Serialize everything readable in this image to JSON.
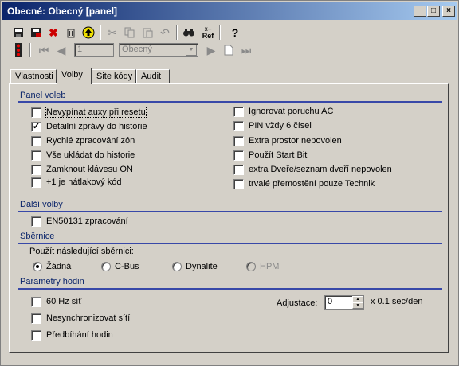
{
  "window": {
    "title": "Obecné: Obecný [panel]",
    "controls": {
      "minimize": "_",
      "maximize": "□",
      "close": "×"
    }
  },
  "toolbar": {
    "icons": [
      "save-icon",
      "save-all-icon",
      "delete-icon",
      "trash-icon",
      "up-icon",
      "cut-icon",
      "copy-icon",
      "paste-icon",
      "undo-icon",
      "find-icon",
      "cross-ref-icon",
      "help-icon"
    ],
    "xref_label": "Ref",
    "help_label": "?"
  },
  "navbar": {
    "record_number": "1",
    "record_name": "Obecný"
  },
  "tabs": [
    {
      "label": "Vlastnosti",
      "active": false
    },
    {
      "label": "Volby",
      "active": true
    },
    {
      "label": "Site kódy",
      "active": false
    },
    {
      "label": "Audit",
      "active": false
    }
  ],
  "panel_options": {
    "title": "Panel voleb",
    "left": [
      {
        "label": "Nevypínat auxy při resetu",
        "checked": false
      },
      {
        "label": "Detailní zprávy do historie",
        "checked": true
      },
      {
        "label": "Rychlé zpracování zón",
        "checked": false
      },
      {
        "label": "Vše ukládat do historie",
        "checked": false
      },
      {
        "label": "Zamknout klávesu ON",
        "checked": false
      },
      {
        "label": "+1 je nátlakový kód",
        "checked": false
      }
    ],
    "right": [
      {
        "label": "Ignorovat poruchu AC",
        "checked": false
      },
      {
        "label": "PIN vždy 6 čísel",
        "checked": false
      },
      {
        "label": "Extra prostor nepovolen",
        "checked": false
      },
      {
        "label": "Použít Start Bit",
        "checked": false
      },
      {
        "label": "extra Dveře/seznam dveří nepovolen",
        "checked": false
      },
      {
        "label": "trvalé přemostění pouze Technik",
        "checked": false
      }
    ]
  },
  "other_options": {
    "title": "Další volby",
    "items": [
      {
        "label": "EN50131 zpracování",
        "checked": false
      }
    ]
  },
  "bus": {
    "title": "Sběrnice",
    "prompt": "Použít následující sběrnici:",
    "options": [
      {
        "label": "Žádná",
        "selected": true,
        "enabled": true
      },
      {
        "label": "C-Bus",
        "selected": false,
        "enabled": true
      },
      {
        "label": "Dynalite",
        "selected": false,
        "enabled": true
      },
      {
        "label": "HPM",
        "selected": false,
        "enabled": false
      }
    ]
  },
  "clock": {
    "title": "Parametry hodin",
    "items": [
      {
        "label": "60 Hz síť",
        "checked": false
      },
      {
        "label": "Nesynchronizovat sítí",
        "checked": false
      },
      {
        "label": "Předbíhání hodin",
        "checked": false
      }
    ],
    "adjust_label": "Adjustace:",
    "adjust_value": "0",
    "adjust_unit": "x 0.1 sec/den"
  }
}
